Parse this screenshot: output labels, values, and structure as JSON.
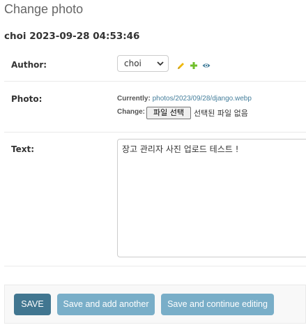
{
  "header": {
    "page_title": "Change photo",
    "object_title": "choi 2023-09-28 04:53:46"
  },
  "form": {
    "author": {
      "label": "Author:",
      "selected": "choi",
      "icons": [
        "pencil-icon",
        "plus-icon",
        "eye-icon"
      ]
    },
    "photo": {
      "label": "Photo:",
      "currently_label": "Currently:",
      "current_file": "photos/2023/09/28/django.webp",
      "change_label": "Change:",
      "file_button": "파일 선택",
      "no_file_text": "선택된 파일 없음"
    },
    "text": {
      "label": "Text:",
      "value": "장고 관리자 사진 업로드 테스트 !"
    }
  },
  "submit": {
    "save": "SAVE",
    "save_add": "Save and add another",
    "save_continue": "Save and continue editing"
  },
  "colors": {
    "primary_button": "#417690",
    "secondary_button": "#79aec8",
    "link": "#447e9b",
    "edit_icon": "#efb80b",
    "add_icon": "#70bf2b",
    "view_icon": "#447e9b"
  }
}
